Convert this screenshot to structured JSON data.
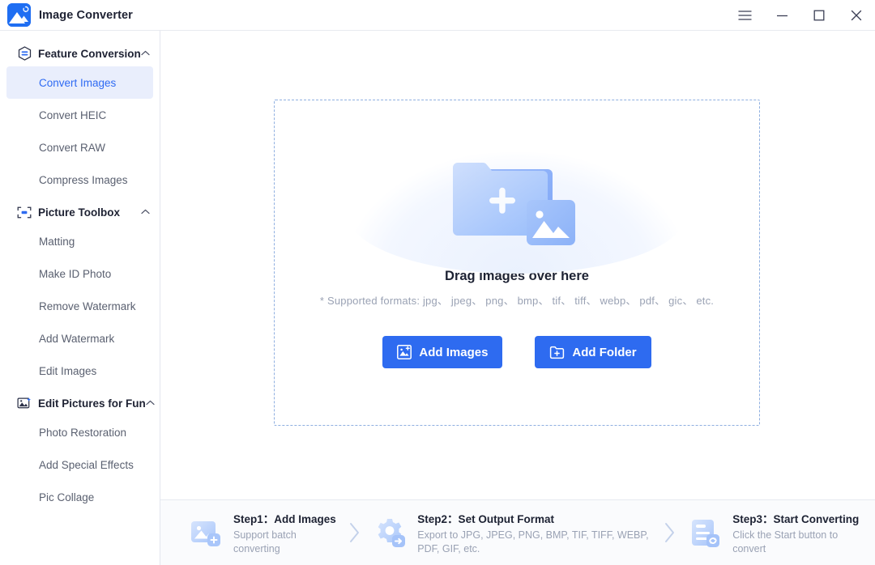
{
  "window": {
    "app_title": "Image Converter",
    "logo_icon": "image-converter-logo-icon",
    "controls": [
      {
        "name": "menu-button",
        "icon": "hamburger-menu-icon"
      },
      {
        "name": "minimize-button",
        "icon": "minimize-icon"
      },
      {
        "name": "maximize-button",
        "icon": "maximize-icon"
      },
      {
        "name": "close-button",
        "icon": "close-icon"
      }
    ]
  },
  "sidebar": {
    "groups": [
      {
        "title": "Feature Conversion",
        "icon": "conversion-hex-icon",
        "chevron": "chevron-up-icon",
        "expanded": true,
        "items": [
          {
            "label": "Convert Images",
            "active": true
          },
          {
            "label": "Convert HEIC",
            "active": false
          },
          {
            "label": "Convert RAW",
            "active": false
          },
          {
            "label": "Compress Images",
            "active": false
          }
        ]
      },
      {
        "title": "Picture Toolbox",
        "icon": "picture-toolbox-icon",
        "chevron": "chevron-up-icon",
        "expanded": true,
        "items": [
          {
            "label": "Matting",
            "active": false
          },
          {
            "label": "Make ID Photo",
            "active": false
          },
          {
            "label": "Remove Watermark",
            "active": false
          },
          {
            "label": "Add Watermark",
            "active": false
          },
          {
            "label": "Edit Images",
            "active": false
          }
        ]
      },
      {
        "title": "Edit Pictures for Fun",
        "icon": "edit-pictures-fun-icon",
        "chevron": "chevron-up-icon",
        "expanded": true,
        "items": [
          {
            "label": "Photo Restoration",
            "active": false
          },
          {
            "label": "Add Special Effects",
            "active": false
          },
          {
            "label": "Pic Collage",
            "active": false
          }
        ]
      }
    ]
  },
  "dropzone": {
    "illustration_icon": "folder-add-image-icon",
    "title": "Drag images over here",
    "formats": "* Supported formats: jpg、 jpeg、 png、 bmp、 tif、 tiff、 webp、 pdf、 gic、 etc.",
    "add_images_label": "Add Images",
    "add_images_icon": "add-image-icon",
    "add_folder_label": "Add Folder",
    "add_folder_icon": "add-folder-icon"
  },
  "steps": [
    {
      "icon": "add-images-step-icon",
      "title": "Step1：Add Images",
      "subtitle": "Support batch converting"
    },
    {
      "icon": "gear-export-step-icon",
      "title": "Step2：Set Output Format",
      "subtitle": "Export to JPG, JPEG, PNG, BMP, TIF, TIFF, WEBP, PDF, GIF, etc."
    },
    {
      "icon": "start-converting-step-icon",
      "title": "Step3：Start Converting",
      "subtitle": "Click the Start button to convert"
    }
  ],
  "step_arrow_icon": "chevron-right-icon",
  "colors": {
    "accent": "#2e6bf0",
    "active_nav_bg": "#e9eefc",
    "active_nav_text": "#2f6bf3",
    "dash_border": "#8fafe0",
    "muted_text": "#9aa2b4",
    "steps_bg": "#fafbfd"
  }
}
